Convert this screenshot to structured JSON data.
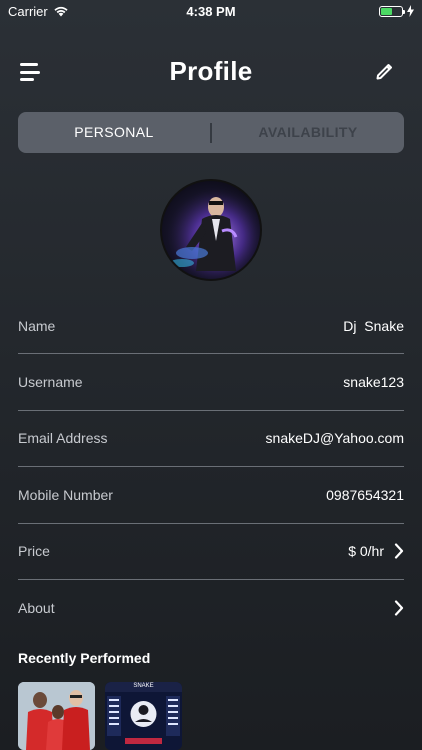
{
  "status_bar": {
    "carrier": "Carrier",
    "time": "4:38 PM"
  },
  "header": {
    "title": "Profile",
    "icons": [
      "menu-icon",
      "edit-pencil-icon"
    ]
  },
  "tabs": [
    {
      "label": "PERSONAL",
      "active": true
    },
    {
      "label": "AVAILABILITY",
      "active": false
    }
  ],
  "profile": {
    "fields": [
      {
        "label": "Name",
        "value": "Dj  Snake",
        "chevron": false
      },
      {
        "label": "Username",
        "value": "snake123",
        "chevron": false
      },
      {
        "label": "Email Address",
        "value": "snakeDJ@Yahoo.com",
        "chevron": false
      },
      {
        "label": "Mobile Number",
        "value": "0987654321",
        "chevron": false
      },
      {
        "label": "Price",
        "value": "$ 0/hr",
        "chevron": true
      },
      {
        "label": "About",
        "value": "",
        "chevron": true
      }
    ]
  },
  "recently_performed": {
    "title": "Recently Performed",
    "thumb2_caption": "SNAKE"
  },
  "colors": {
    "accent_battery": "#4cd964",
    "segment_bg": "#5b6069",
    "divider": "#6a6f76"
  }
}
